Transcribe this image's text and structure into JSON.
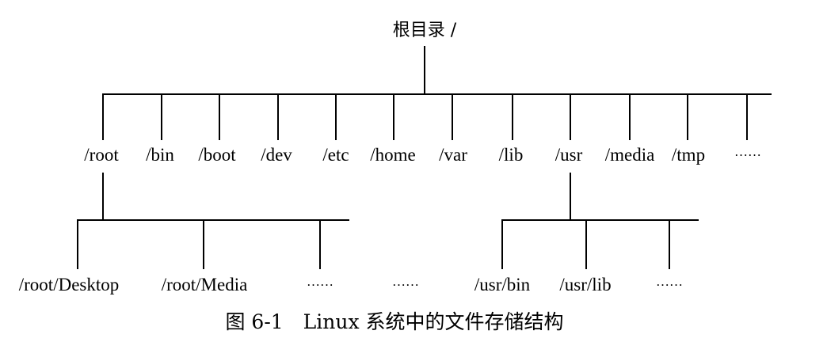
{
  "root": {
    "label": "根目录 /"
  },
  "level1": {
    "root": "/root",
    "bin": "/bin",
    "boot": "/boot",
    "dev": "/dev",
    "etc": "/etc",
    "home": "/home",
    "var": "/var",
    "lib": "/lib",
    "usr": "/usr",
    "media": "/media",
    "tmp": "/tmp",
    "more": "……"
  },
  "root_children": {
    "desktop": "/root/Desktop",
    "media": "/root/Media",
    "more": "……"
  },
  "between_ellipsis": "……",
  "usr_children": {
    "bin": "/usr/bin",
    "lib": "/usr/lib",
    "more": "……"
  },
  "caption": "图 6-1　Linux 系统中的文件存储结构"
}
